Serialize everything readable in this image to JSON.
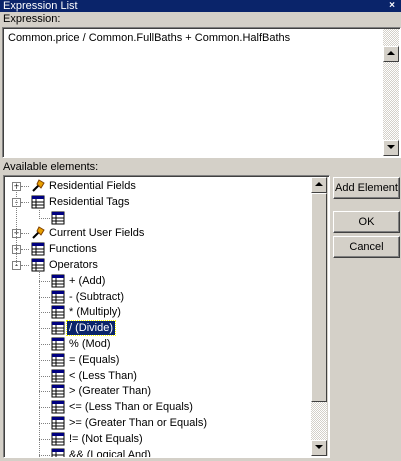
{
  "window": {
    "title": "Expression List",
    "close_glyph": "×"
  },
  "expression": {
    "label": "Expression:",
    "value": "Common.price  / Common.FullBaths + Common.HalfBaths"
  },
  "elements": {
    "label": "Available elements:",
    "tree": [
      {
        "label": "Residential Fields",
        "icon": "wand-icon",
        "expander": "+"
      },
      {
        "label": "Residential Tags",
        "icon": "table-icon",
        "expander": "-"
      },
      {
        "label": "",
        "icon": "table-icon"
      },
      {
        "label": "Current User Fields",
        "icon": "wand-icon",
        "expander": "+"
      },
      {
        "label": "Functions",
        "icon": "table-icon",
        "expander": "+"
      },
      {
        "label": "Operators",
        "icon": "table-icon",
        "expander": "-"
      },
      {
        "label": "+ (Add)",
        "icon": "table-icon"
      },
      {
        "label": "- (Subtract)",
        "icon": "table-icon"
      },
      {
        "label": "* (Multiply)",
        "icon": "table-icon"
      },
      {
        "label": "/ (Divide)",
        "icon": "table-icon",
        "selected": true
      },
      {
        "label": "% (Mod)",
        "icon": "table-icon"
      },
      {
        "label": "= (Equals)",
        "icon": "table-icon"
      },
      {
        "label": "< (Less Than)",
        "icon": "table-icon"
      },
      {
        "label": "> (Greater Than)",
        "icon": "table-icon"
      },
      {
        "label": "<= (Less Than or Equals)",
        "icon": "table-icon"
      },
      {
        "label": ">= (Greater Than or Equals)",
        "icon": "table-icon"
      },
      {
        "label": "!= (Not Equals)",
        "icon": "table-icon"
      },
      {
        "label": "&& (Logical And)",
        "icon": "table-icon"
      }
    ]
  },
  "buttons": {
    "add_element": "Add Element",
    "ok": "OK",
    "cancel": "Cancel"
  },
  "colors": {
    "titlebar": "#0a246a",
    "selection": "#0a246a",
    "face": "#d4d0c8"
  }
}
